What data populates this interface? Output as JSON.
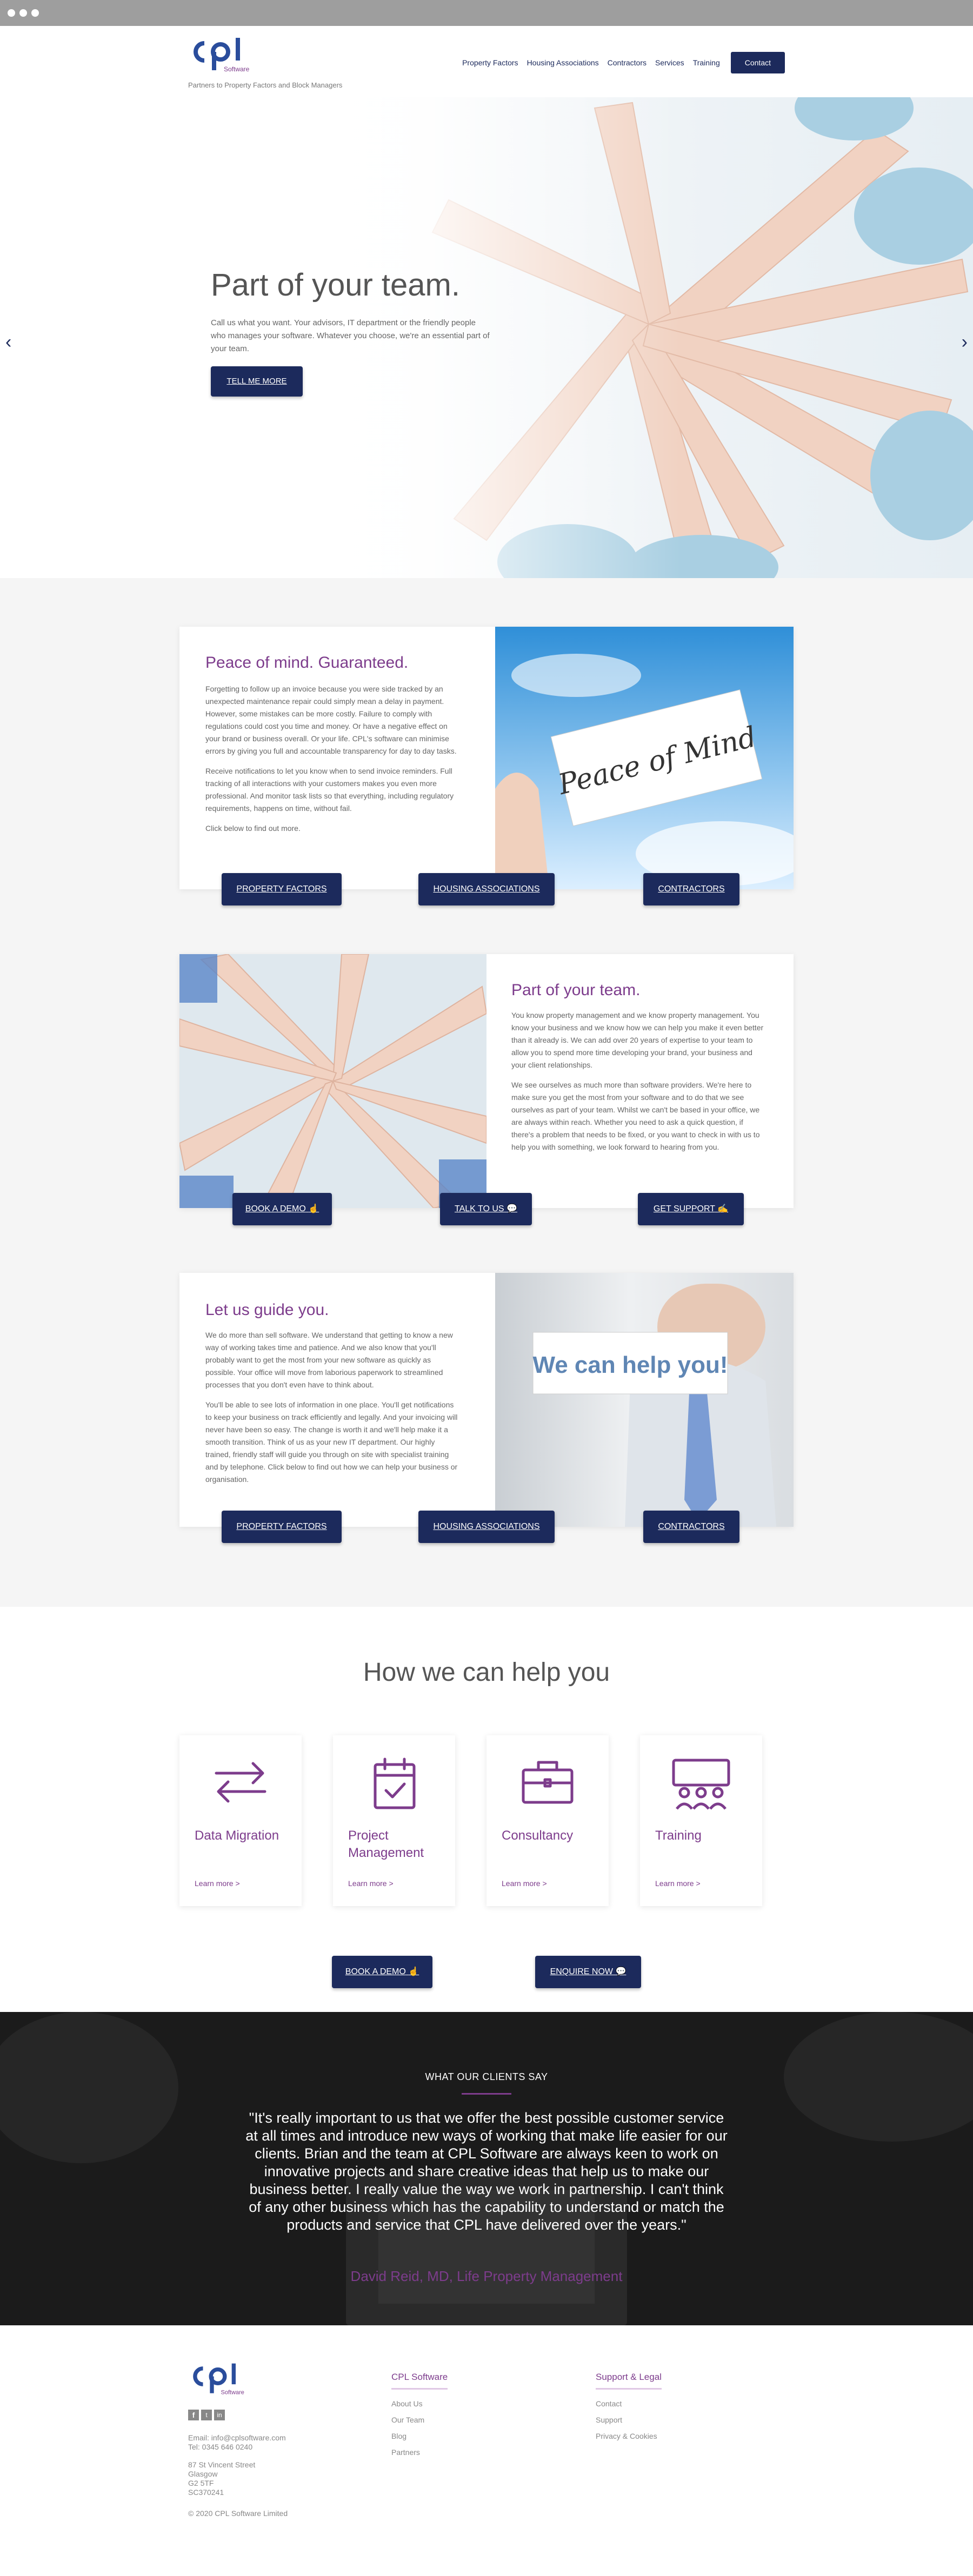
{
  "header": {
    "tagline": "Partners to Property Factors and Block Managers",
    "logo_text": "cpl",
    "logo_sub": "Software",
    "nav": [
      "Property Factors",
      "Housing Associations",
      "Contractors",
      "Services",
      "Training"
    ],
    "contact": "Contact"
  },
  "hero": {
    "title": "Part of your team.",
    "text": "Call us what you want. Your advisors, IT department or the friendly people who manages your software. Whatever you choose, we're an essential part of your team.",
    "button": "TELL ME MORE",
    "prev_icon": "chevron-left-icon",
    "next_icon": "chevron-right-icon"
  },
  "card1": {
    "title": "Peace of mind. Guaranteed.",
    "p1": "Forgetting to follow up an invoice because you were side tracked by an unexpected maintenance repair could simply mean a delay in payment. However, some mistakes can be more costly. Failure to comply with regulations could cost you time and money. Or have a negative effect on your brand or business overall. Or your life. CPL's software can minimise errors by giving you full and accountable transparency for day to day tasks.",
    "p2": "Receive notifications to let you know when to send invoice reminders. Full tracking of all interactions with your customers makes you even more professional. And monitor task lists so that everything, including regulatory requirements, happens on time, without fail.",
    "p3": "Click below to find out more.",
    "img_text": "Peace of Mind",
    "buttons": [
      "PROPERTY FACTORS",
      "HOUSING ASSOCIATIONS",
      "CONTRACTORS"
    ]
  },
  "card2": {
    "title": "Part of your team.",
    "p1": "You know property management and we know property management. You know your business and we know how we can help you make it even better than it already is. We can add over 20 years of expertise to your team to allow you to spend more time developing your brand, your business and your client relationships.",
    "p2": "We see ourselves as much more than software providers. We're here to make sure you get the most from your software and to do that we see ourselves as part of your team. Whilst we can't be based in your office, we are always within reach. Whether you need to ask a quick question, if there's a problem that needs to be fixed, or you want to check in with us to help you with something, we look forward to hearing from you.",
    "buttons": [
      "BOOK A DEMO",
      "TALK TO US",
      "GET SUPPORT"
    ]
  },
  "card3": {
    "title": "Let us guide you.",
    "p1": "We do more than sell software. We understand that getting to know a new way of working takes time and patience. And we also know that you'll probably want to get the most from your new software as quickly as possible. Your office will move from laborious paperwork to streamlined processes that you don't even have to think about.",
    "p2": "You'll be able to see lots of information in one place. You'll get notifications to keep your business on track efficiently and legally. And your invoicing will never have been so easy. The change is worth it and we'll help make it a smooth transition. Think of us as your new IT department. Our highly trained, friendly staff will guide you through on site with specialist training and by telephone. Click below to find out how we can help your business or organisation.",
    "img_text": "We can help you!",
    "buttons": [
      "PROPERTY FACTORS",
      "HOUSING ASSOCIATIONS",
      "CONTRACTORS"
    ]
  },
  "help": {
    "title": "How we can help you",
    "items": [
      {
        "title": "Data Migration",
        "icon": "arrows-swap-icon",
        "more": "Learn more >"
      },
      {
        "title": "Project Management",
        "icon": "calendar-check-icon",
        "more": "Learn more >"
      },
      {
        "title": "Consultancy",
        "icon": "briefcase-icon",
        "more": "Learn more >"
      },
      {
        "title": "Training",
        "icon": "group-training-icon",
        "more": "Learn more >"
      }
    ],
    "buttons": [
      "BOOK A DEMO",
      "ENQUIRE NOW"
    ]
  },
  "testimonial": {
    "label": "WHAT OUR CLIENTS SAY",
    "quote": "\"It's really important to us that we offer the best possible customer service at all times and introduce new ways of working that make life easier for our clients. Brian and the team at CPL Software are always keen to work on innovative projects and share creative ideas that help us to make our business better. I really value the way we work in partnership. I can't think of any other business which has the capability to understand or match the products and service that CPL have delivered over the years.\"",
    "author": "David Reid, MD, Life Property Management"
  },
  "footer": {
    "social": [
      "facebook-icon",
      "twitter-icon",
      "linkedin-icon"
    ],
    "email": "Email: info@cplsoftware.com",
    "tel": "Tel: 0345 646 0240",
    "address": [
      "87 St Vincent Street",
      "Glasgow",
      "G2 5TF",
      "SC370241"
    ],
    "copyright": "© 2020 CPL Software Limited",
    "col1": {
      "title": "CPL Software",
      "links": [
        "About Us",
        "Our Team",
        "Blog",
        "Partners"
      ]
    },
    "col2": {
      "title": "Support & Legal",
      "links": [
        "Contact",
        "Support",
        "Privacy & Cookies"
      ]
    }
  },
  "colors": {
    "navy": "#1c2a5c",
    "purple": "#7d3c8c"
  }
}
